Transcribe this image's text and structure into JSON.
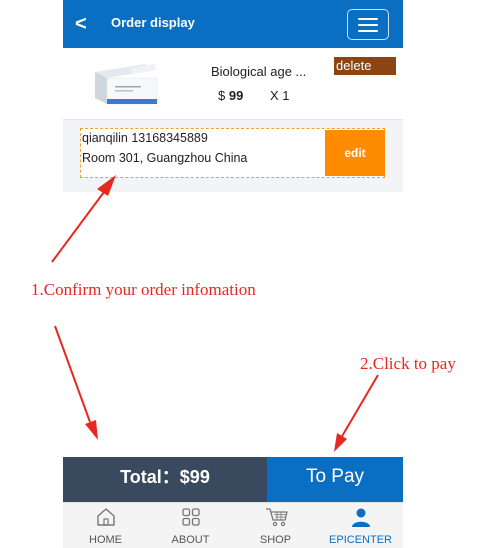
{
  "header": {
    "title": "Order display",
    "back_icon": "chevron-left-icon",
    "menu_icon": "hamburger-icon"
  },
  "product": {
    "name": "Biological age ...",
    "currency": "$",
    "price": "99",
    "quantity": "X 1",
    "delete_label": "delete",
    "thumbnail_icon": "product-box-icon"
  },
  "address": {
    "line1": "qianqilin 13168345889",
    "line2": "Room 301,  Guangzhou China",
    "edit_label": "edit"
  },
  "checkout": {
    "total_label": "Total：$99",
    "pay_label": "To Pay"
  },
  "tabbar": {
    "items": [
      {
        "label": "HOME",
        "icon": "home-icon",
        "active": false
      },
      {
        "label": "ABOUT",
        "icon": "grid-icon",
        "active": false
      },
      {
        "label": "SHOP",
        "icon": "cart-icon",
        "active": false
      },
      {
        "label": "EPICENTER",
        "icon": "user-icon",
        "active": true
      }
    ]
  },
  "annotations": {
    "step1": "1.Confirm your order infomation",
    "step2": "2.Click to pay",
    "color": "#e8281e"
  },
  "colors": {
    "primary": "#0a6fc2",
    "delete": "#8b4513",
    "edit": "#ff8c00",
    "total_bg": "#3a4a5e"
  }
}
